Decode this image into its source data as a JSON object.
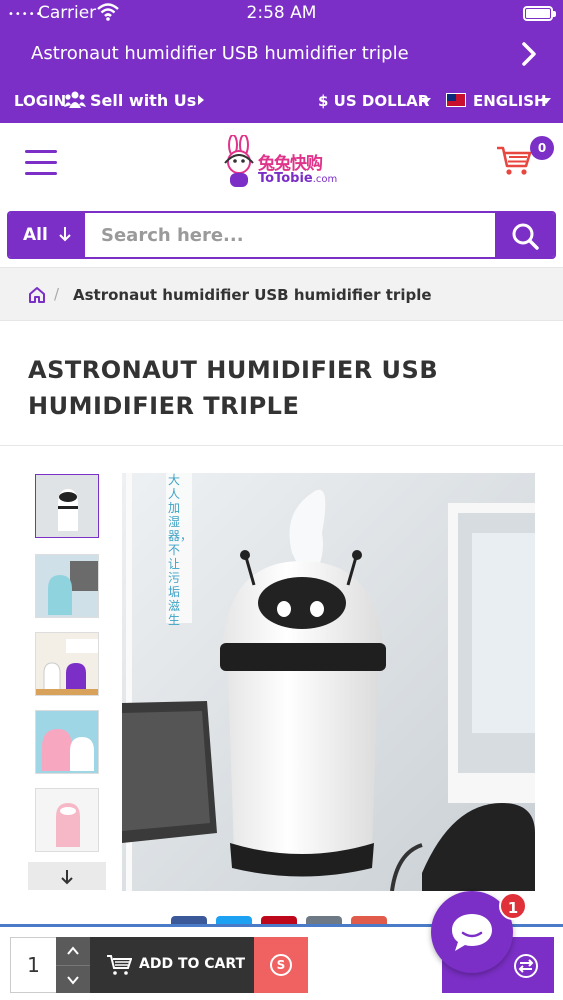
{
  "status_bar": {
    "carrier": "Carrier",
    "time": "2:58 AM"
  },
  "header": {
    "title": "Astronaut humidifier USB humidifier triple",
    "login_label": "LOGIN",
    "sell_label": "Sell with Us",
    "currency_label": "$ US DOLLAR",
    "language_label": "ENGLISH"
  },
  "logo": {
    "chinese_text": "兔兔快购",
    "brand_text": "ToTobie",
    "brand_suffix": ".com"
  },
  "cart": {
    "count": "0"
  },
  "search": {
    "category_label": "All",
    "placeholder": "Search here..."
  },
  "breadcrumb": {
    "separator": "/",
    "current": "Astronaut humidifier USB humidifier triple"
  },
  "product": {
    "title": "ASTRONAUT HUMIDIFIER USB HUMIDIFIER TRIPLE",
    "image_side_text": "大人加湿器，不让污垢滋生"
  },
  "bottom_bar": {
    "quantity": "1",
    "add_to_cart_label": "ADD TO CART",
    "buy_now_symbol": "S"
  },
  "chat": {
    "badge_count": "1"
  },
  "colors": {
    "brand_purple": "#7b2fc6",
    "buy_red": "#f06262",
    "badge_red": "#e0303a",
    "logo_pink": "#e0338a"
  },
  "icons": [
    "wifi-icon",
    "battery-icon",
    "chevron-right-icon",
    "users-icon",
    "flag-uk-icon",
    "menu-icon",
    "cart-icon",
    "arrow-down-icon",
    "search-icon",
    "home-icon",
    "cart-add-icon",
    "dollar-circle-icon",
    "compare-icon",
    "chat-icon"
  ]
}
